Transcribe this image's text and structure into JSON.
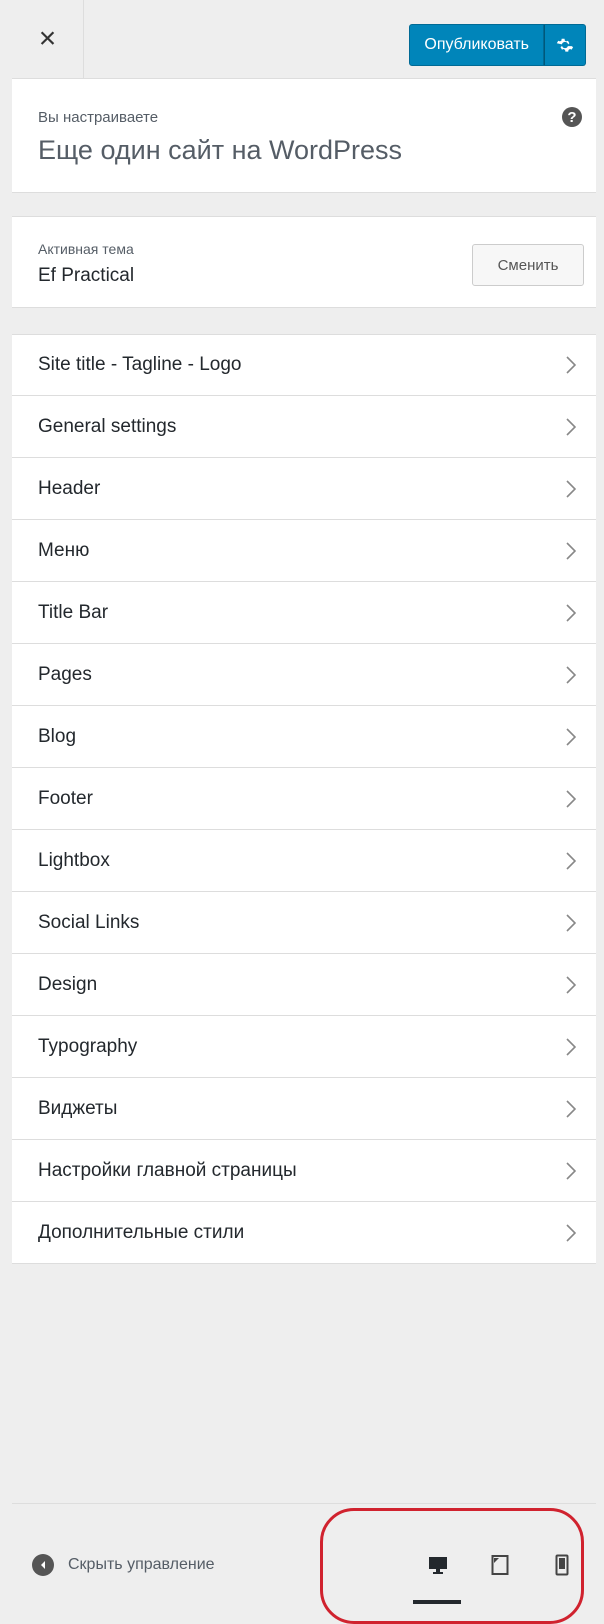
{
  "header": {
    "close_symbol": "×",
    "publish_label": "Опубликовать",
    "gear_icon": "gear-icon"
  },
  "info": {
    "customizing_label": "Вы настраиваете",
    "site_title": "Еще один сайт на WordPress",
    "help_symbol": "?"
  },
  "theme": {
    "active_label": "Активная тема",
    "name": "Ef Practical",
    "change_label": "Сменить"
  },
  "menu": [
    {
      "label": "Site title - Tagline - Logo"
    },
    {
      "label": "General settings"
    },
    {
      "label": "Header"
    },
    {
      "label": "Меню"
    },
    {
      "label": "Title Bar"
    },
    {
      "label": "Pages"
    },
    {
      "label": "Blog"
    },
    {
      "label": "Footer"
    },
    {
      "label": "Lightbox"
    },
    {
      "label": "Social Links"
    },
    {
      "label": "Design"
    },
    {
      "label": "Typography"
    },
    {
      "label": "Виджеты"
    },
    {
      "label": "Настройки главной страницы"
    },
    {
      "label": "Дополнительные стили"
    }
  ],
  "footer": {
    "collapse_label": "Скрыть управление",
    "devices": [
      {
        "name": "desktop",
        "active": true
      },
      {
        "name": "tablet",
        "active": false
      },
      {
        "name": "mobile",
        "active": false
      }
    ]
  },
  "colors": {
    "accent": "#0085ba",
    "highlight": "#d0222e",
    "background": "#eeeeee"
  }
}
